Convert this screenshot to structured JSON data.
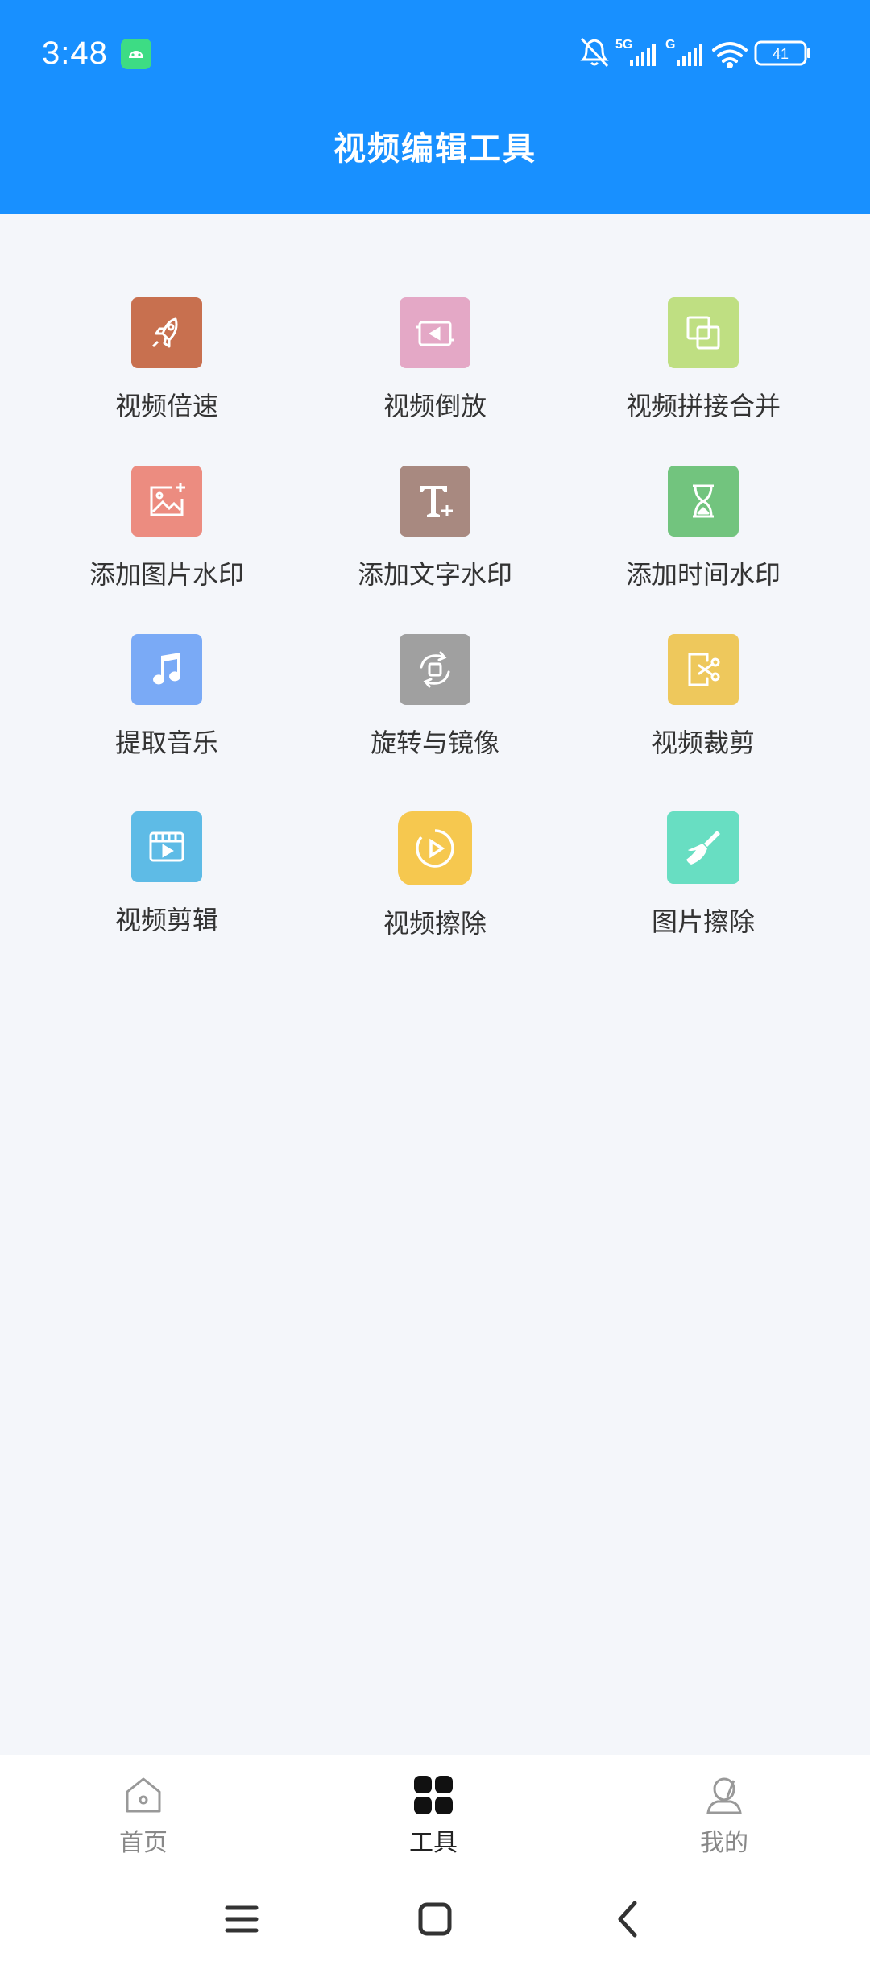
{
  "status_bar": {
    "time": "3:48",
    "network_label_1": "5G",
    "network_label_2": "G",
    "battery": "41",
    "icons": [
      "android-icon",
      "bell-off-icon",
      "signal-icon",
      "signal-icon",
      "wifi-icon",
      "battery-icon"
    ]
  },
  "header": {
    "title": "视频编辑工具",
    "color": "#1890FF"
  },
  "tools": [
    {
      "label": "视频倍速",
      "icon": "rocket-icon",
      "color": "#C8704F"
    },
    {
      "label": "视频倒放",
      "icon": "reverse-play-icon",
      "color": "#E4A8C6"
    },
    {
      "label": "视频拼接合并",
      "icon": "merge-icon",
      "color": "#BFDF82"
    },
    {
      "label": "添加图片水印",
      "icon": "image-add-icon",
      "color": "#EC8C80"
    },
    {
      "label": "添加文字水印",
      "icon": "text-add-icon",
      "color": "#A88980"
    },
    {
      "label": "添加时间水印",
      "icon": "hourglass-icon",
      "color": "#72C47E"
    },
    {
      "label": "提取音乐",
      "icon": "music-icon",
      "color": "#7AAAF6"
    },
    {
      "label": "旋转与镜像",
      "icon": "rotate-icon",
      "color": "#A0A0A0"
    },
    {
      "label": "视频裁剪",
      "icon": "crop-cut-icon",
      "color": "#EEC85C"
    },
    {
      "label": "视频剪辑",
      "icon": "clapper-icon",
      "color": "#5EBBE6"
    },
    {
      "label": "视频擦除",
      "icon": "play-circle-icon",
      "color": "#F6C84F"
    },
    {
      "label": "图片擦除",
      "icon": "broom-icon",
      "color": "#68DEC2"
    }
  ],
  "bottom_nav": [
    {
      "label": "首页",
      "icon": "home-icon",
      "active": false
    },
    {
      "label": "工具",
      "icon": "grid-icon",
      "active": true
    },
    {
      "label": "我的",
      "icon": "profile-icon",
      "active": false
    }
  ],
  "system_nav": [
    "menu-icon",
    "home-square-icon",
    "back-icon"
  ]
}
